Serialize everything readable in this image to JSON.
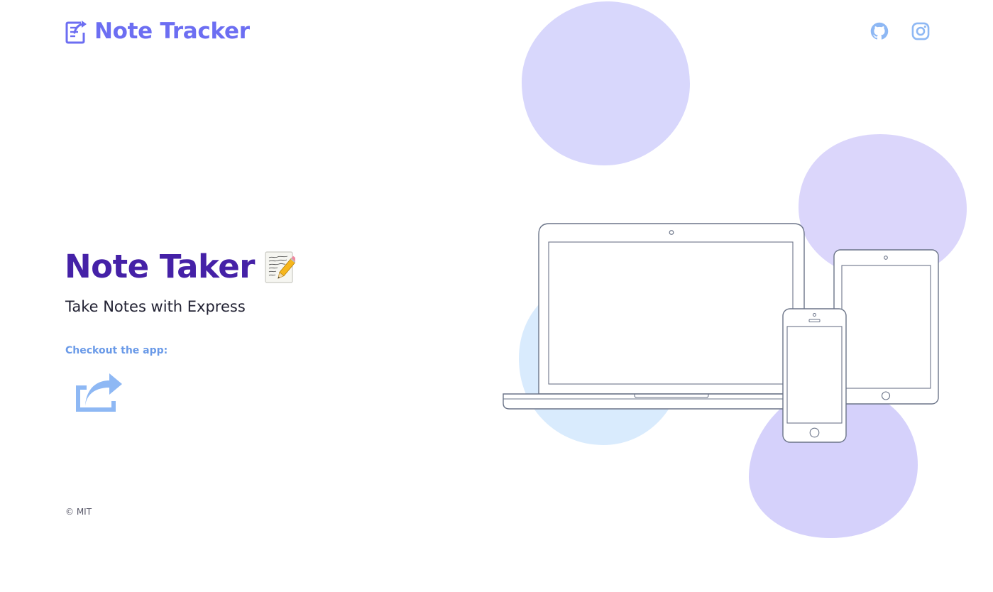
{
  "header": {
    "brand": "Note Tracker",
    "logo_icon": "edit-document-icon",
    "social": [
      {
        "name": "github",
        "icon": "github-icon"
      },
      {
        "name": "instagram",
        "icon": "instagram-icon"
      }
    ]
  },
  "hero": {
    "title": "Note Taker",
    "title_icon": "memo-icon",
    "subtitle": "Take Notes with Express",
    "checkout_label": "Checkout the app:",
    "open_app_icon": "share-icon"
  },
  "footer": {
    "copyright": "© MIT"
  },
  "illustration": {
    "devices": [
      "laptop",
      "tablet",
      "phone"
    ]
  },
  "colors": {
    "brand": "#6c6ef2",
    "title": "#4521a7",
    "link": "#6a9ae8",
    "icon_light": "#8eb8f4",
    "blob_purple": "#d7d5fb",
    "blob_blue": "#d8eafd",
    "device_stroke": "#6b7488"
  }
}
